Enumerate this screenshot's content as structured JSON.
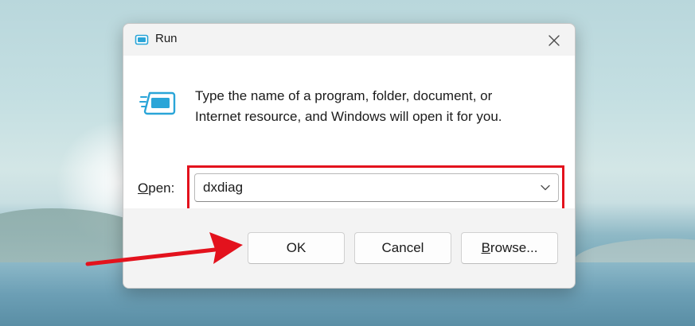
{
  "window": {
    "title": "Run",
    "icon": "run-icon",
    "close_icon": "close-icon"
  },
  "dialog": {
    "description_line1": "Type the name of a program, folder, document, or",
    "description_line2": "Internet resource, and Windows will open it for you.",
    "open_label_prefix": "O",
    "open_label_rest": "pen:",
    "open_value": "dxdiag",
    "dropdown_icon": "chevron-down-icon"
  },
  "buttons": {
    "ok_label": "OK",
    "cancel_label": "Cancel",
    "browse_prefix": "B",
    "browse_rest": "rowse..."
  },
  "annotation": {
    "highlight_color": "#e3121d",
    "arrow_color": "#e3121d"
  },
  "colors": {
    "dialog_background": "#f3f3f3",
    "content_background": "#ffffff",
    "accent_blue": "#2aa5d8"
  }
}
